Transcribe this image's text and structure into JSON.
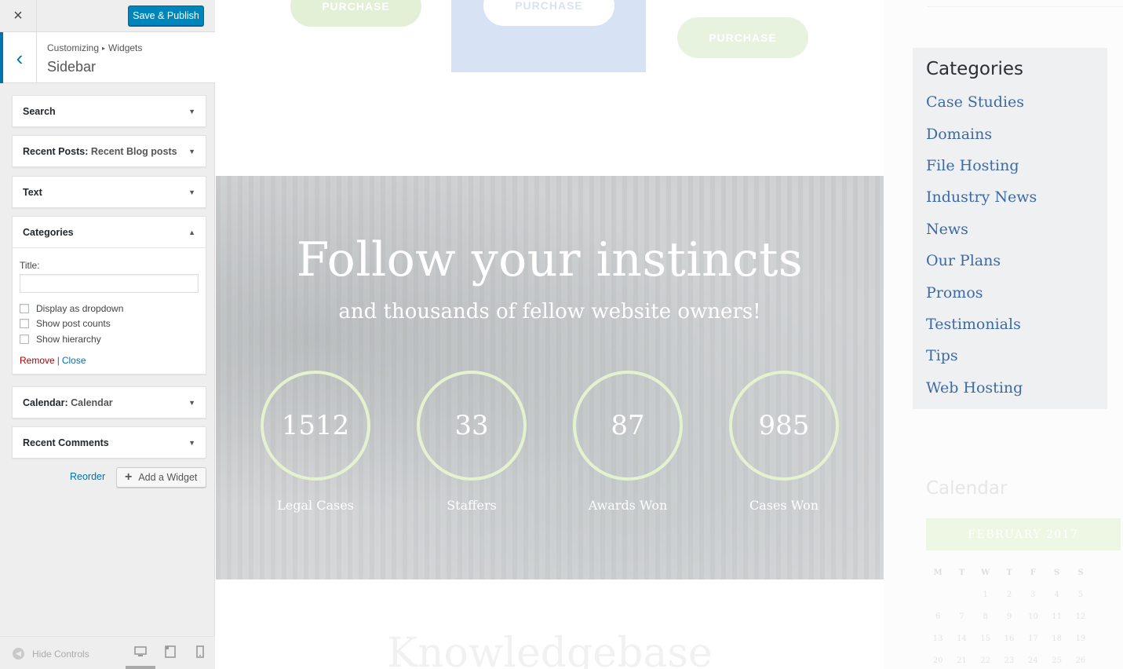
{
  "customizer": {
    "close_icon": "×",
    "save_label": "Save & Publish",
    "back_icon": "‹",
    "breadcrumb_root": "Customizing",
    "breadcrumb_sep": "▸",
    "breadcrumb_leaf": "Widgets",
    "section_title": "Sidebar",
    "widgets": [
      {
        "title": "Search",
        "subtitle": ""
      },
      {
        "title": "Recent Posts:",
        "subtitle": "Recent Blog posts"
      },
      {
        "title": "Text",
        "subtitle": ""
      },
      {
        "title": "Categories",
        "subtitle": ""
      },
      {
        "title": "Calendar:",
        "subtitle": "Calendar"
      },
      {
        "title": "Recent Comments",
        "subtitle": ""
      }
    ],
    "categories_form": {
      "title_label": "Title:",
      "title_value": "",
      "options": [
        "Display as dropdown",
        "Show post counts",
        "Show hierarchy"
      ],
      "remove_label": "Remove",
      "separator": "|",
      "close_label": "Close"
    },
    "reorder_label": "Reorder",
    "add_widget_label": "Add a Widget",
    "hide_controls_label": "Hide Controls",
    "colors": {
      "primary": "#0073aa",
      "save": "#0085ba",
      "remove": "#aa0000"
    }
  },
  "preview": {
    "purchase_label": "PURCHASE",
    "hero": {
      "title": "Follow your instincts",
      "subtitle": "and thousands of fellow website owners!",
      "stats": [
        {
          "value": "1512",
          "label": "Legal Cases"
        },
        {
          "value": "33",
          "label": "Staffers"
        },
        {
          "value": "87",
          "label": "Awards Won"
        },
        {
          "value": "985",
          "label": "Cases Won"
        }
      ]
    },
    "knowledgebase_title": "Knowledgebase",
    "categories": {
      "title": "Categories",
      "items": [
        "Case Studies",
        "Domains",
        "File Hosting",
        "Industry News",
        "News",
        "Our Plans",
        "Promos",
        "Testimonials",
        "Tips",
        "Web Hosting"
      ]
    },
    "calendar": {
      "title": "Calendar",
      "month": "FEBRUARY 2017",
      "weekdays": [
        "M",
        "T",
        "W",
        "T",
        "F",
        "S",
        "S"
      ],
      "weeks": [
        [
          "",
          "",
          "1",
          "2",
          "3",
          "4",
          "5"
        ],
        [
          "6",
          "7",
          "8",
          "9",
          "10",
          "11",
          "12"
        ],
        [
          "13",
          "14",
          "15",
          "16",
          "17",
          "18",
          "19"
        ],
        [
          "20",
          "21",
          "22",
          "23",
          "24",
          "25",
          "26"
        ]
      ]
    },
    "colors": {
      "link": "#3d6aa5",
      "ring": "#e4f2d0",
      "plan_blue": "#d7e3f5"
    }
  }
}
